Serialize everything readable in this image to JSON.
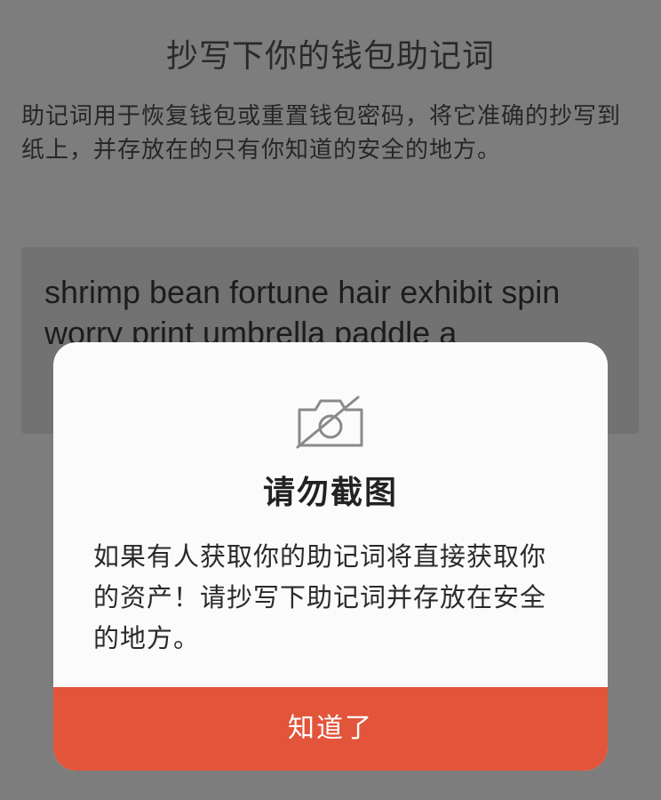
{
  "page": {
    "title": "抄写下你的钱包助记词",
    "description": "助记词用于恢复钱包或重置钱包密码，将它准确的抄写到纸上，并存放在的只有你知道的安全的地方。",
    "mnemonic": "shrimp bean fortune hair exhibit spin worry print umbrella paddle a"
  },
  "dialog": {
    "icon": "no-camera-icon",
    "title": "请勿截图",
    "message": "如果有人获取你的助记词将直接获取你的资产！请抄写下助记词并存放在安全的地方。",
    "confirm_label": "知道了"
  },
  "colors": {
    "overlay": "#7d7d7d",
    "dialog_background": "#fbfbfb",
    "accent": "#e2553a"
  }
}
